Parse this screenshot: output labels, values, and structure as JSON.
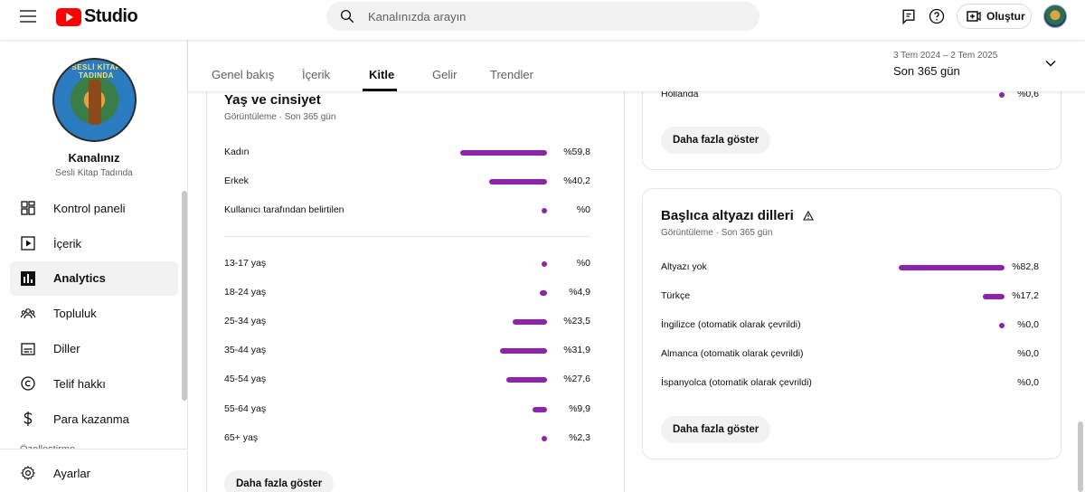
{
  "app": {
    "logo_text": "Studio"
  },
  "search": {
    "placeholder": "Kanalınızda arayın"
  },
  "topbar": {
    "create_label": "Oluştur"
  },
  "channel": {
    "name": "Kanalınız",
    "subtitle": "Sesli Kitap Tadında",
    "avatar_text": "SESLİ KİTAP TADINDA"
  },
  "sidebar": {
    "items": [
      {
        "label": "Kontrol paneli",
        "icon": "dashboard-icon"
      },
      {
        "label": "İçerik",
        "icon": "content-icon"
      },
      {
        "label": "Analytics",
        "icon": "analytics-icon",
        "active": true
      },
      {
        "label": "Topluluk",
        "icon": "community-icon"
      },
      {
        "label": "Diller",
        "icon": "subtitles-icon"
      },
      {
        "label": "Telif hakkı",
        "icon": "copyright-icon"
      },
      {
        "label": "Para kazanma",
        "icon": "dollar-icon"
      }
    ],
    "cut_item": "Özelleştirme",
    "settings_label": "Ayarlar"
  },
  "tabs": [
    "Genel bakış",
    "İçerik",
    "Kitle",
    "Gelir",
    "Trendler"
  ],
  "active_tab": "Kitle",
  "date_range": {
    "dates": "3 Tem 2024 – 2 Tem 2025",
    "label": "Son 365 gün"
  },
  "age_gender": {
    "title": "Yaş ve cinsiyet",
    "subtitle": "Görüntüleme · Son 365 gün",
    "gender": [
      {
        "label": "Kadın",
        "value": "%59,8",
        "pct": 59.8
      },
      {
        "label": "Erkek",
        "value": "%40,2",
        "pct": 40.2
      },
      {
        "label": "Kullanıcı tarafından belirtilen",
        "value": "%0",
        "pct": 0
      }
    ],
    "ages": [
      {
        "label": "13-17 yaş",
        "value": "%0",
        "pct": 0
      },
      {
        "label": "18-24 yaş",
        "value": "%4,9",
        "pct": 4.9
      },
      {
        "label": "25-34 yaş",
        "value": "%23,5",
        "pct": 23.5
      },
      {
        "label": "35-44 yaş",
        "value": "%31,9",
        "pct": 31.9
      },
      {
        "label": "45-54 yaş",
        "value": "%27,6",
        "pct": 27.6
      },
      {
        "label": "55-64 yaş",
        "value": "%9,9",
        "pct": 9.9
      },
      {
        "label": "65+ yaş",
        "value": "%2,3",
        "pct": 2.3
      }
    ],
    "more_label": "Daha fazla göster"
  },
  "geo": {
    "rows": [
      {
        "label": "Hollanda",
        "value": "%0,6",
        "pct": 0.6
      }
    ],
    "more_label": "Daha fazla göster"
  },
  "subtitles": {
    "title": "Başlıca altyazı dilleri",
    "subtitle": "Görüntüleme · Son 365 gün",
    "rows": [
      {
        "label": "Altyazı yok",
        "value": "%82,8",
        "pct": 82.8
      },
      {
        "label": "Türkçe",
        "value": "%17,2",
        "pct": 17.2
      },
      {
        "label": "İngilizce (otomatik olarak çevrildi)",
        "value": "%0,0",
        "pct": 0.01
      },
      {
        "label": "Almanca (otomatik olarak çevrildi)",
        "value": "%0,0",
        "pct": 0
      },
      {
        "label": "İspanyolca (otomatik olarak çevrildi)",
        "value": "%0,0",
        "pct": 0
      }
    ],
    "more_label": "Daha fazla göster"
  },
  "colors": {
    "accent_bar": "#8e24aa",
    "brand_red": "#ff0000"
  }
}
